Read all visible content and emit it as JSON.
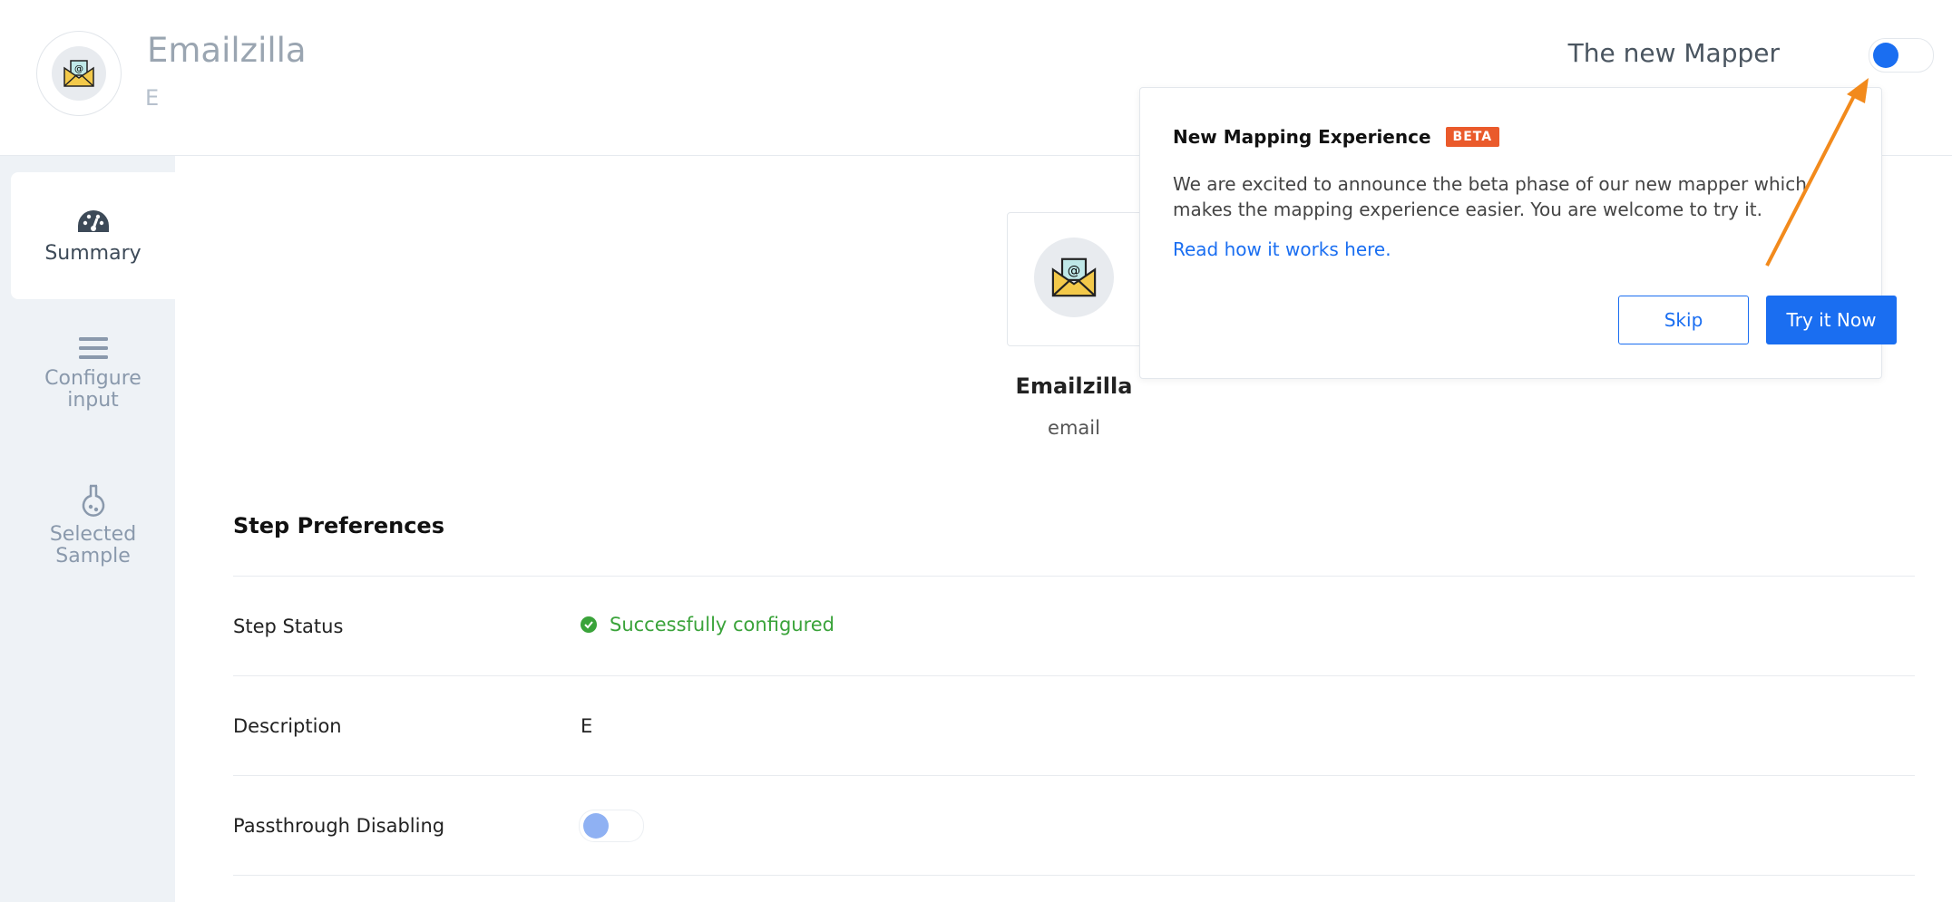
{
  "header": {
    "app_title": "Emailzilla",
    "app_subtitle": "E",
    "mapper_label": "The new Mapper"
  },
  "sidebar": {
    "items": [
      {
        "label": "Summary",
        "icon": "dashboard-icon",
        "active": true
      },
      {
        "label": "Configure input",
        "icon": "list-icon",
        "active": false
      },
      {
        "label": "Selected Sample",
        "icon": "flask-icon",
        "active": false
      }
    ]
  },
  "main": {
    "card_name": "Emailzilla",
    "card_type": "email",
    "section_title": "Step Preferences",
    "rows": [
      {
        "label": "Step Status",
        "value": "Successfully configured"
      },
      {
        "label": "Description",
        "value": "E"
      },
      {
        "label": "Passthrough Disabling",
        "value": ""
      }
    ]
  },
  "popover": {
    "title": "New Mapping Experience",
    "badge": "BETA",
    "text": "We are excited to announce the beta phase of our new mapper which makes the mapping experience easier. You are welcome to try it.",
    "link": "Read how it works here.",
    "skip_label": "Skip",
    "try_label": "Try it Now"
  },
  "colors": {
    "accent": "#1a6ef1",
    "success": "#3aa33a",
    "beta": "#ea5a2b",
    "annotation_arrow": "#f28a1c",
    "sidebar_bg": "#eef2f6"
  }
}
